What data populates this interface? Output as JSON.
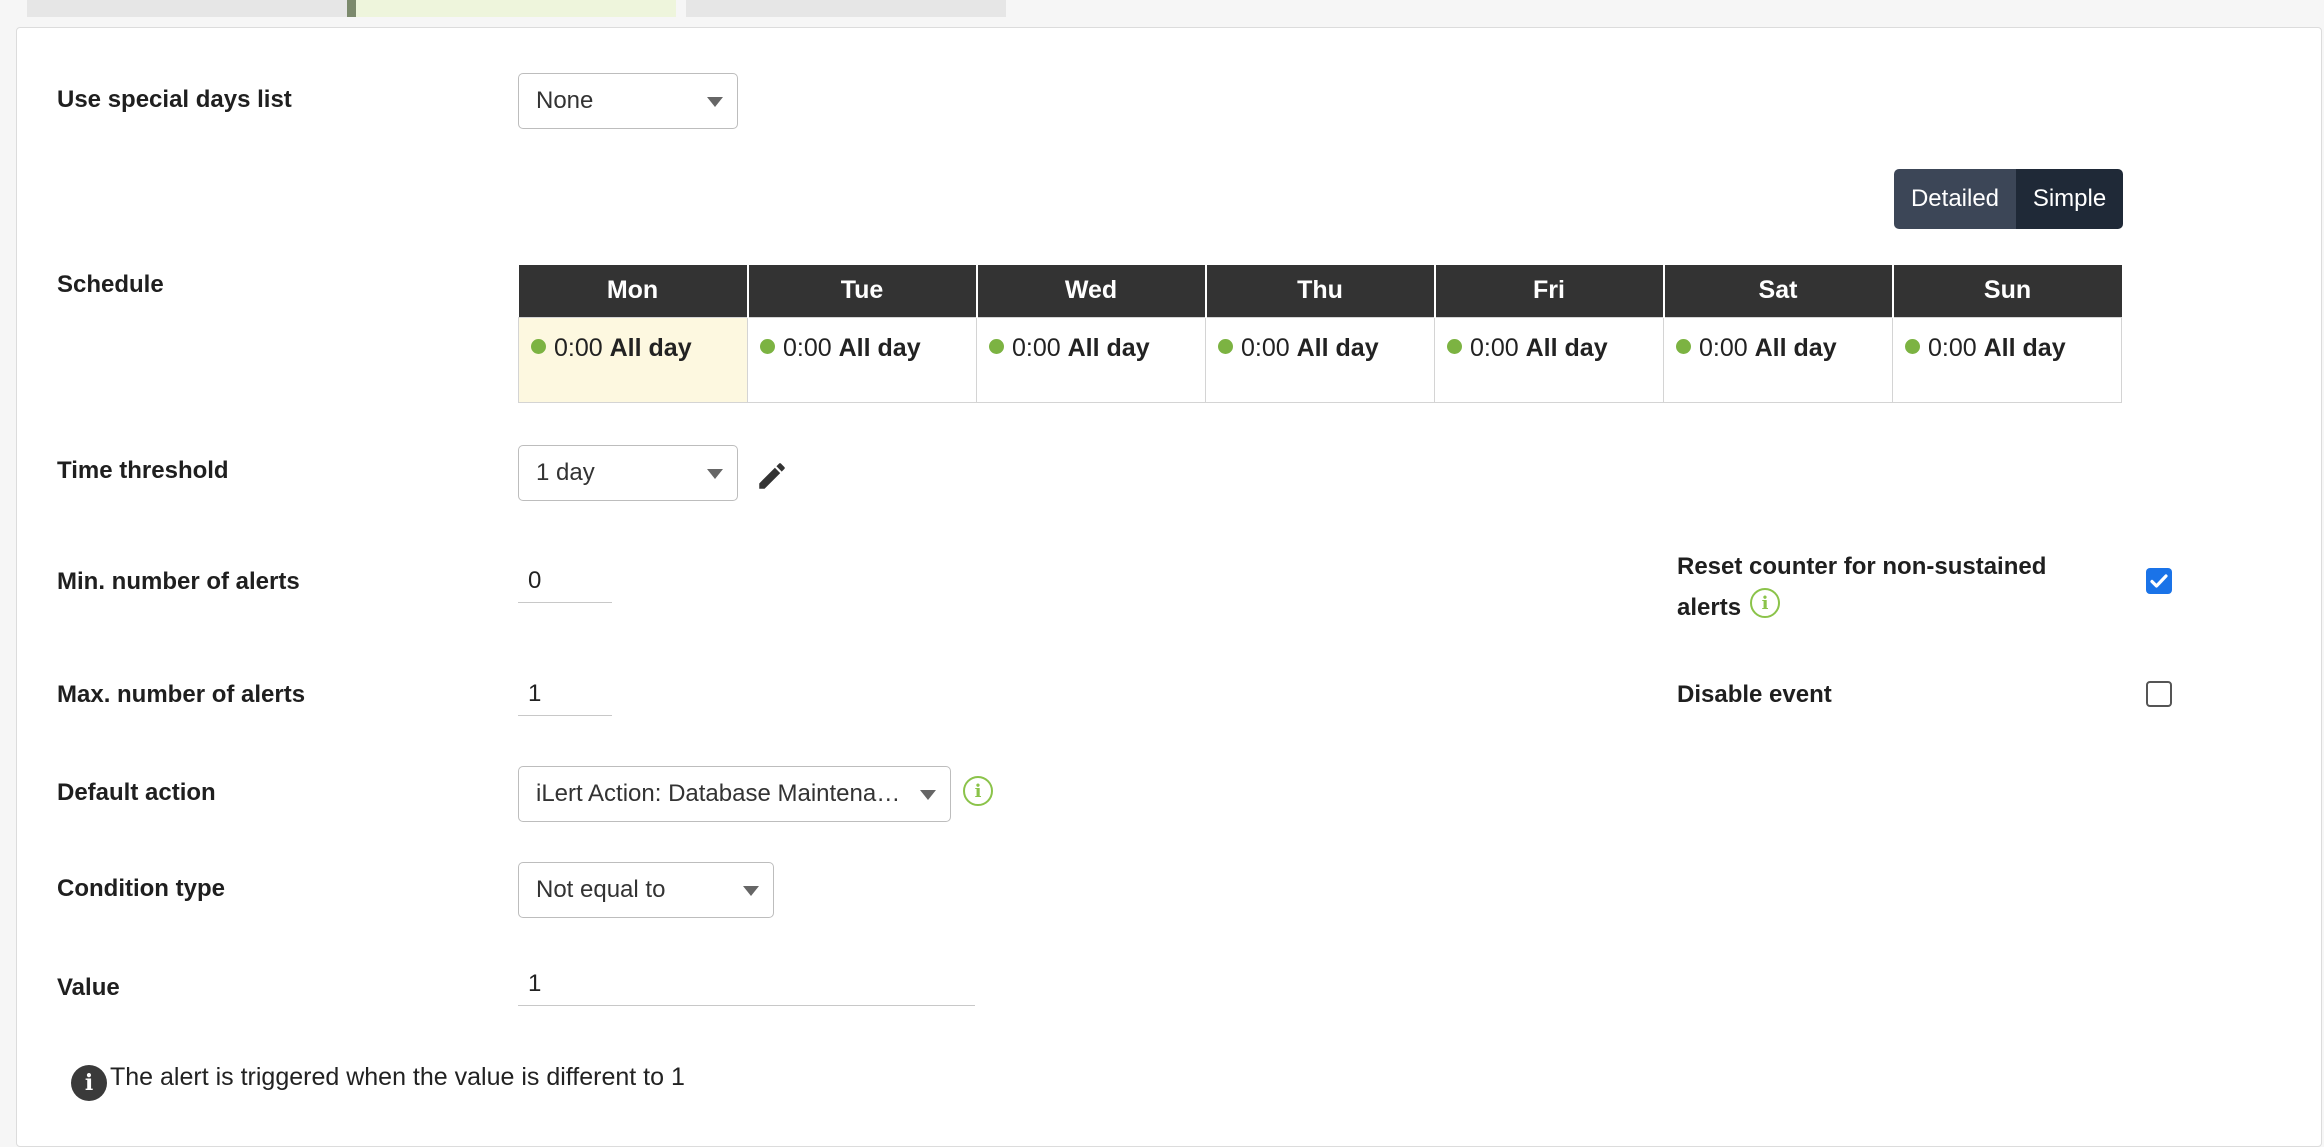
{
  "labels": {
    "special_days": "Use special days list",
    "schedule": "Schedule",
    "time_threshold": "Time threshold",
    "min_alerts": "Min. number of alerts",
    "max_alerts": "Max. number of alerts",
    "default_action": "Default action",
    "condition_type": "Condition type",
    "value": "Value",
    "reset_counter_line1": "Reset counter for non-sustained",
    "reset_counter_line2": "alerts",
    "disable_event": "Disable event"
  },
  "fields": {
    "special_days": "None",
    "time_threshold": "1 day",
    "min_alerts": "0",
    "max_alerts": "1",
    "default_action": "iLert Action: Database Maintenan…",
    "condition_type": "Not equal to",
    "value": "1"
  },
  "view_toggle": {
    "detailed": "Detailed",
    "simple": "Simple",
    "selected": "Simple"
  },
  "schedule": {
    "days": [
      "Mon",
      "Tue",
      "Wed",
      "Thu",
      "Fri",
      "Sat",
      "Sun"
    ],
    "cells": [
      {
        "time": "0:00",
        "label": "All day"
      },
      {
        "time": "0:00",
        "label": "All day"
      },
      {
        "time": "0:00",
        "label": "All day"
      },
      {
        "time": "0:00",
        "label": "All day"
      },
      {
        "time": "0:00",
        "label": "All day"
      },
      {
        "time": "0:00",
        "label": "All day"
      },
      {
        "time": "0:00",
        "label": "All day"
      }
    ]
  },
  "checkboxes": {
    "reset_counter": true,
    "disable_event": false
  },
  "info_note": "The alert is triggered when the value is different to 1",
  "colors": {
    "accent_green": "#8bc34a",
    "checkbox_blue": "#1a73e8",
    "header_dark": "#333333"
  }
}
